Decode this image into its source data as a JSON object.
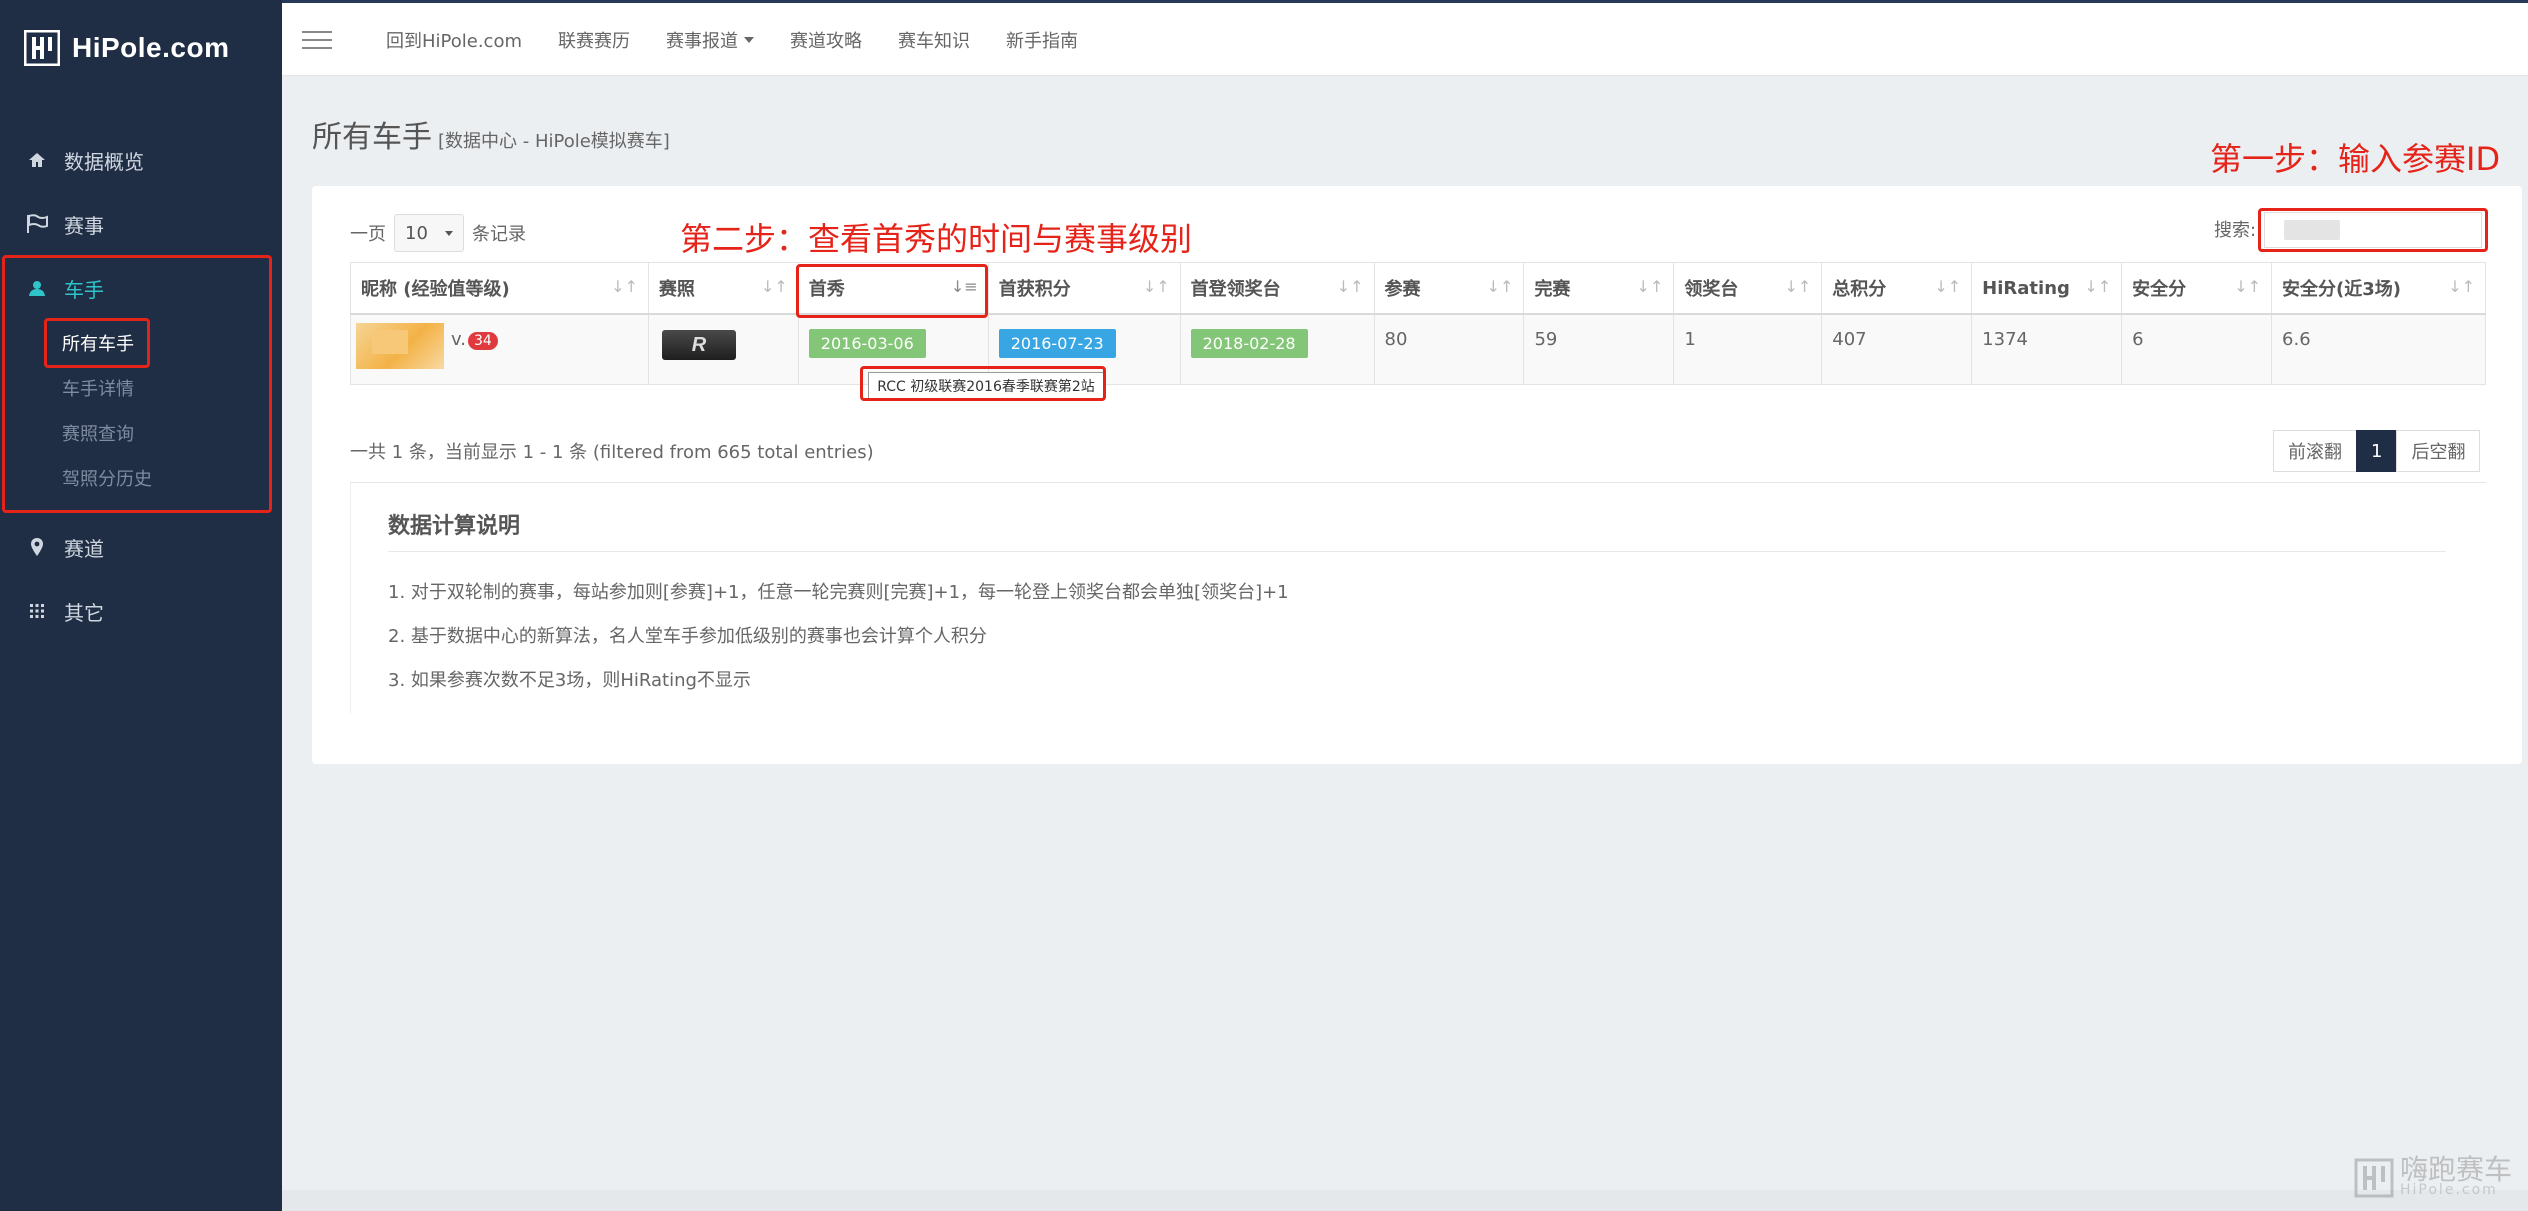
{
  "app": {
    "logo_text": "HiPole.com"
  },
  "sidebar": {
    "items": [
      {
        "label": "数据概览",
        "icon": "home-icon"
      },
      {
        "label": "赛事",
        "icon": "flag-icon"
      },
      {
        "label": "车手",
        "icon": "user-icon"
      },
      {
        "label": "赛道",
        "icon": "map-marker-icon"
      },
      {
        "label": "其它",
        "icon": "grid-icon"
      }
    ],
    "driver_sub": [
      "所有车手",
      "车手详情",
      "赛照查询",
      "驾照分历史"
    ]
  },
  "topnav": [
    "回到HiPole.com",
    "联赛赛历",
    "赛事报道",
    "赛道攻略",
    "赛车知识",
    "新手指南"
  ],
  "page": {
    "title": "所有车手",
    "subtitle": "[数据中心 - HiPole模拟赛车]"
  },
  "controls": {
    "length_prefix": "一页",
    "length_value": "10",
    "length_suffix": "条记录",
    "search_label": "搜索:"
  },
  "table": {
    "headers": [
      "昵称 (经验值等级)",
      "赛照",
      "首秀",
      "首获积分",
      "首登领奖台",
      "参赛",
      "完赛",
      "领奖台",
      "总积分",
      "HiRating",
      "安全分",
      "安全分(近3场)"
    ],
    "row": {
      "level_prefix": "v.",
      "level": "34",
      "license": "R",
      "debut": "2016-03-06",
      "first_points": "2016-07-23",
      "first_podium": "2018-02-28",
      "races": "80",
      "finishes": "59",
      "podiums": "1",
      "total_points": "407",
      "hirating": "1374",
      "safety": "6",
      "safety_recent": "6.6"
    },
    "debut_tooltip": "RCC 初级联赛2016春季联赛第2站"
  },
  "info": "一共 1 条，当前显示 1 - 1 条 (filtered from 665 total entries)",
  "pager": {
    "prev": "前滚翻",
    "current": "1",
    "next": "后空翻"
  },
  "notes": {
    "title": "数据计算说明",
    "lines": [
      "1. 对于双轮制的赛事，每站参加则[参赛]+1，任意一轮完赛则[完赛]+1，每一轮登上领奖台都会单独[领奖台]+1",
      "2. 基于数据中心的新算法，名人堂车手参加低级别的赛事也会计算个人积分",
      "3. 如果参赛次数不足3场，则HiRating不显示"
    ]
  },
  "annotations": {
    "step1": "第一步：输入参赛ID",
    "step2": "第二步：查看首秀的时间与赛事级别"
  },
  "watermark": {
    "text": "嗨跑赛车",
    "sub": "HiPole.com"
  },
  "colors": {
    "sidebar": "#1f2e45",
    "accent": "#2ec4c8",
    "annotation": "#e52319",
    "badge_green": "#84c677",
    "badge_blue": "#39a6e4"
  }
}
